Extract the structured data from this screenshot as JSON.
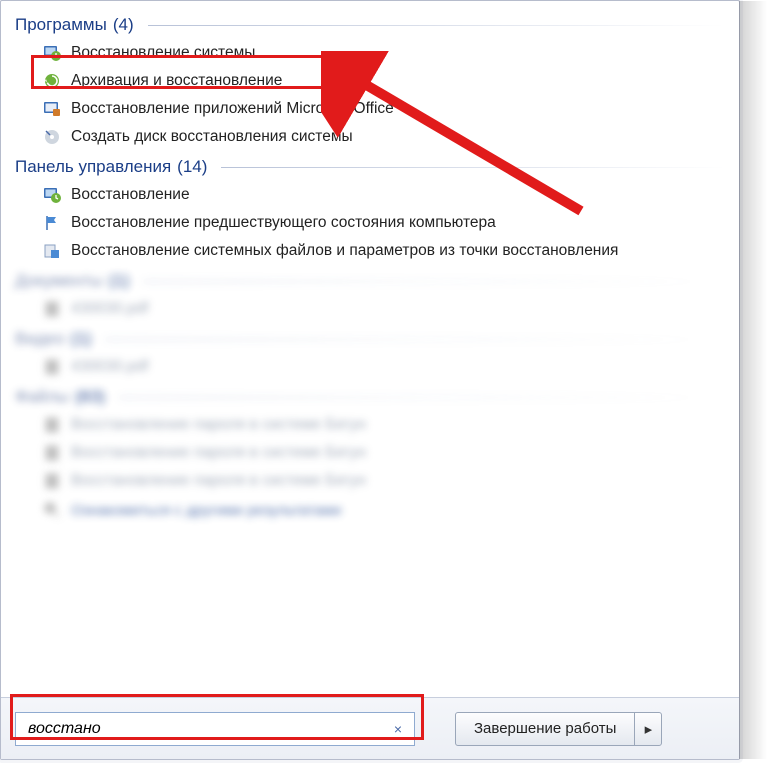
{
  "groups": {
    "programs": {
      "title": "Программы",
      "count": "(4)",
      "items": [
        {
          "label": "Восстановление системы",
          "icon": "restore-monitor"
        },
        {
          "label": "Архивация и восстановление",
          "icon": "backup-restore"
        },
        {
          "label": "Восстановление приложений Microsoft Office",
          "icon": "office-repair"
        },
        {
          "label": "Создать диск восстановления системы",
          "icon": "create-disc"
        }
      ]
    },
    "control_panel": {
      "title": "Панель управления",
      "count": "(14)",
      "items": [
        {
          "label": "Восстановление",
          "icon": "restore-clock"
        },
        {
          "label": "Восстановление предшествующего состояния компьютера",
          "icon": "flag"
        },
        {
          "label": "Восстановление системных файлов и параметров из точки восстановления",
          "icon": "sysfiles"
        }
      ]
    },
    "documents": {
      "title": "Документы",
      "count": "(1)",
      "items": [
        {
          "label": "430030.pdf",
          "icon": "pdf"
        }
      ]
    },
    "video": {
      "title": "Видео",
      "count": "(1)",
      "items": [
        {
          "label": "430030.pdf",
          "icon": "pdf"
        }
      ]
    },
    "files": {
      "title": "Файлы",
      "count": "(83)",
      "items": [
        {
          "label": "Восстановление пароля в системе Бегун",
          "icon": "doc"
        },
        {
          "label": "Восстановление пароля в системе Бегун",
          "icon": "doc"
        },
        {
          "label": "Восстановление пароля в системе Бегун",
          "icon": "doc"
        }
      ]
    }
  },
  "see_more": "Ознакомиться с другими результатами",
  "search": {
    "value": "восстано",
    "clear_glyph": "×"
  },
  "shutdown": {
    "label": "Завершение работы",
    "arrow": "▸"
  }
}
